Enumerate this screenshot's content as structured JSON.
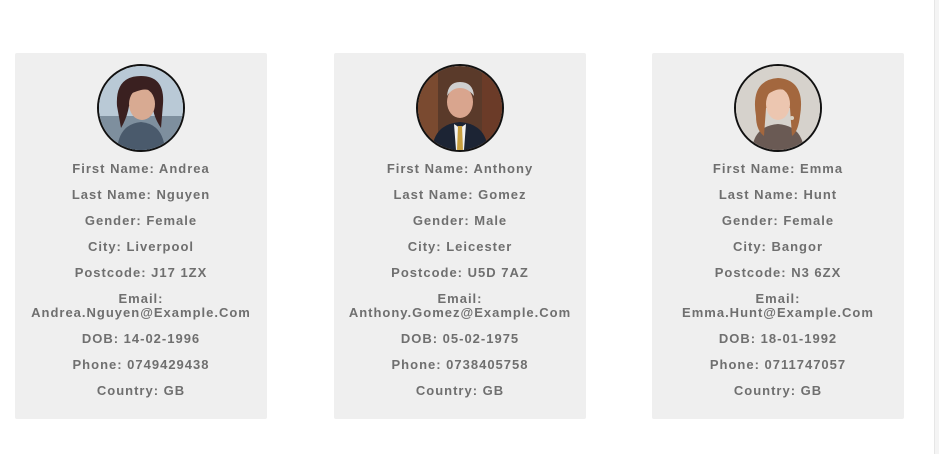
{
  "cards": [
    {
      "first_name": "First Name: Andrea",
      "last_name": "Last Name: Nguyen",
      "gender": "Gender: Female",
      "city": "City: Liverpool",
      "postcode": "Postcode: J17 1ZX",
      "email_label": "Email:",
      "email_value": "Andrea.Nguyen@Example.Com",
      "dob": "DOB: 14-02-1996",
      "phone": "Phone: 0749429438",
      "country": "Country: GB"
    },
    {
      "first_name": "First Name: Anthony",
      "last_name": "Last Name: Gomez",
      "gender": "Gender: Male",
      "city": "City: Leicester",
      "postcode": "Postcode: U5D 7AZ",
      "email_label": "Email:",
      "email_value": "Anthony.Gomez@Example.Com",
      "dob": "DOB: 05-02-1975",
      "phone": "Phone: 0738405758",
      "country": "Country: GB"
    },
    {
      "first_name": "First Name: Emma",
      "last_name": "Last Name: Hunt",
      "gender": "Gender: Female",
      "city": "City: Bangor",
      "postcode": "Postcode: N3 6ZX",
      "email_label": "Email:",
      "email_value": "Emma.Hunt@Example.Com",
      "dob": "DOB: 18-01-1992",
      "phone": "Phone: 0711747057",
      "country": "Country: GB"
    }
  ],
  "colors": {
    "card_background": "#efefef",
    "text": "#6f6f6f",
    "avatar_border": "#111111"
  }
}
